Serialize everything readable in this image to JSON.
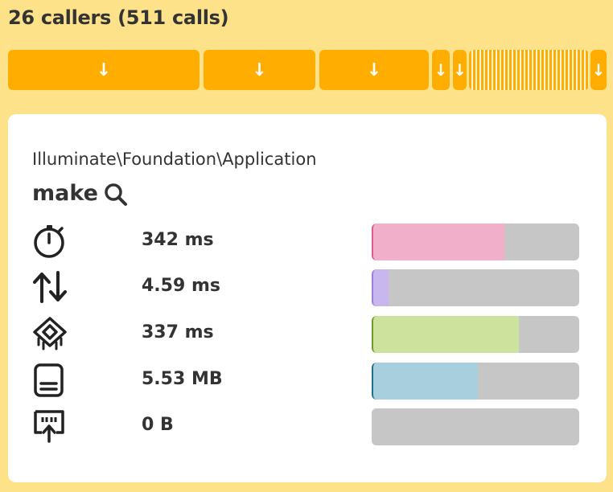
{
  "header": {
    "title": "26 callers (511 calls)"
  },
  "callers_bar": {
    "segments": [
      {
        "label": "↓"
      },
      {
        "label": "↓"
      },
      {
        "label": "↓"
      },
      {
        "label": "↓"
      },
      {
        "label": "↓"
      },
      {
        "label": "↓"
      }
    ]
  },
  "details": {
    "namespace": "Illuminate\\Foundation\\Application",
    "method": "make",
    "metrics": [
      {
        "icon": "stopwatch-icon",
        "value": "342 ms",
        "fill": 0.64,
        "color": "#f2afca",
        "edge": "#e05a90"
      },
      {
        "icon": "io-arrows-icon",
        "value": "4.59 ms",
        "fill": 0.08,
        "color": "#c8b6ee",
        "edge": "#9a7fe0"
      },
      {
        "icon": "cpu-icon",
        "value": "337 ms",
        "fill": 0.71,
        "color": "#cde29c",
        "edge": "#6e9a2a"
      },
      {
        "icon": "memory-icon",
        "value": "5.53 MB",
        "fill": 0.51,
        "color": "#a8cfdd",
        "edge": "#1f6f8f"
      },
      {
        "icon": "network-icon",
        "value": "0 B",
        "fill": 0.0,
        "color": "#bfe2ef",
        "edge": "#4aa3c6"
      }
    ]
  }
}
